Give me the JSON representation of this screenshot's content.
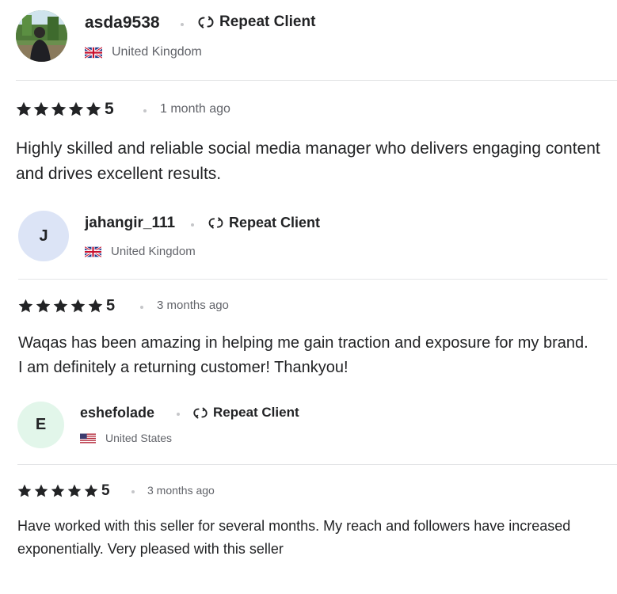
{
  "reviews": [
    {
      "username": "asda9538",
      "avatar_type": "photo",
      "avatar_letter": "",
      "repeat_label": "Repeat Client",
      "country": "United Kingdom",
      "flag": "gb",
      "rating": "5",
      "stars": 5,
      "time": "1 month ago",
      "text": "Highly skilled and reliable social media manager who delivers engaging content and drives excellent results."
    },
    {
      "username": "jahangir_111",
      "avatar_type": "letter",
      "avatar_letter": "J",
      "avatar_color": "#dce4f6",
      "repeat_label": "Repeat Client",
      "country": "United Kingdom",
      "flag": "gb",
      "rating": "5",
      "stars": 5,
      "time": "3 months ago",
      "text": "Waqas has been amazing in helping me gain traction and exposure for my brand. I am definitely a returning customer! Thankyou!"
    },
    {
      "username": "eshefolade",
      "avatar_type": "letter",
      "avatar_letter": "E",
      "avatar_color": "#e2f6ea",
      "repeat_label": "Repeat Client",
      "country": "United States",
      "flag": "us",
      "rating": "5",
      "stars": 5,
      "time": "3 months ago",
      "text": "Have worked with this seller for several months. My reach and followers have increased exponentially. Very pleased with this seller"
    }
  ]
}
